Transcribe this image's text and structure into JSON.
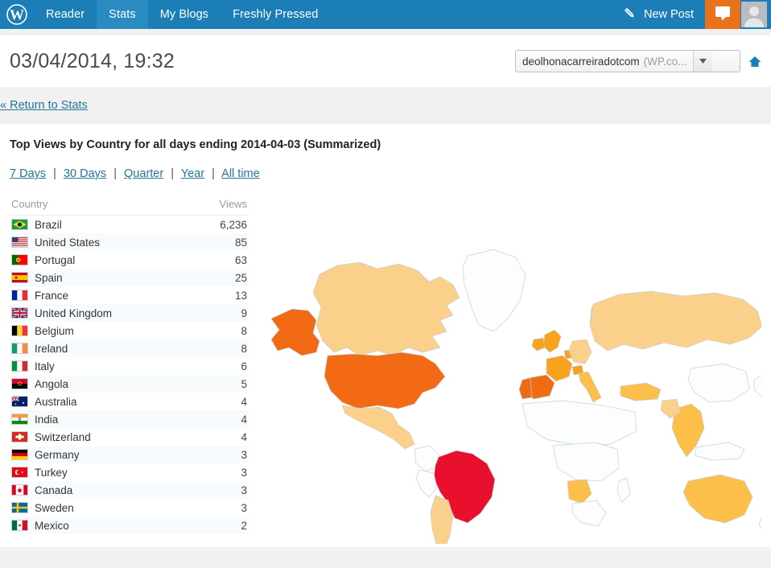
{
  "masterbar": {
    "logo_icon": "wordpress-logo-icon",
    "items": [
      {
        "label": "Reader",
        "active": false
      },
      {
        "label": "Stats",
        "active": true
      },
      {
        "label": "My Blogs",
        "active": false
      },
      {
        "label": "Freshly Pressed",
        "active": false
      }
    ],
    "new_post_label": "New Post",
    "new_post_icon": "pencil-icon",
    "notification_icon": "comment-bubble-icon",
    "avatar_icon": "user-avatar-icon",
    "bar_color": "#1c7eb6",
    "active_color": "#2a8bc0",
    "notification_color": "#e8731c"
  },
  "header": {
    "title": "03/04/2014, 19:32",
    "site_name": "deolhonacarreiradotcom",
    "site_suffix": "(WP.co...",
    "dropdown_icon": "chevron-down-icon",
    "home_icon": "home-icon"
  },
  "return": {
    "label": "« Return to Stats"
  },
  "panel": {
    "heading": "Top Views by Country for all days ending 2014-04-03 (Summarized)",
    "periods": [
      {
        "label": "7 Days"
      },
      {
        "label": "30 Days"
      },
      {
        "label": "Quarter"
      },
      {
        "label": "Year"
      },
      {
        "label": "All time"
      }
    ],
    "separator": "|"
  },
  "table": {
    "columns": [
      "Country",
      "Views"
    ],
    "rows": [
      {
        "country": "Brazil",
        "views": "6,236",
        "flag": "br"
      },
      {
        "country": "United States",
        "views": "85",
        "flag": "us"
      },
      {
        "country": "Portugal",
        "views": "63",
        "flag": "pt"
      },
      {
        "country": "Spain",
        "views": "25",
        "flag": "es"
      },
      {
        "country": "France",
        "views": "13",
        "flag": "fr"
      },
      {
        "country": "United Kingdom",
        "views": "9",
        "flag": "gb"
      },
      {
        "country": "Belgium",
        "views": "8",
        "flag": "be"
      },
      {
        "country": "Ireland",
        "views": "8",
        "flag": "ie"
      },
      {
        "country": "Italy",
        "views": "6",
        "flag": "it"
      },
      {
        "country": "Angola",
        "views": "5",
        "flag": "ao"
      },
      {
        "country": "Australia",
        "views": "4",
        "flag": "au"
      },
      {
        "country": "India",
        "views": "4",
        "flag": "in"
      },
      {
        "country": "Switzerland",
        "views": "4",
        "flag": "ch"
      },
      {
        "country": "Germany",
        "views": "3",
        "flag": "de"
      },
      {
        "country": "Turkey",
        "views": "3",
        "flag": "tr"
      },
      {
        "country": "Canada",
        "views": "3",
        "flag": "ca"
      },
      {
        "country": "Sweden",
        "views": "3",
        "flag": "se"
      },
      {
        "country": "Mexico",
        "views": "2",
        "flag": "mx"
      }
    ]
  },
  "chart_data": {
    "type": "heatmap",
    "title": "Top Views by Country for all days ending 2014-04-03 (Summarized)",
    "xlabel": "",
    "ylabel": "Views",
    "categories": [
      "Brazil",
      "United States",
      "Portugal",
      "Spain",
      "France",
      "United Kingdom",
      "Belgium",
      "Ireland",
      "Italy",
      "Angola",
      "Australia",
      "India",
      "Switzerland",
      "Germany",
      "Turkey",
      "Canada",
      "Sweden",
      "Mexico"
    ],
    "values": [
      6236,
      85,
      63,
      25,
      13,
      9,
      8,
      8,
      6,
      5,
      4,
      4,
      4,
      3,
      3,
      3,
      3,
      2
    ],
    "legend_position": "none",
    "grid": false,
    "color_scale": {
      "highest": "#e8102d",
      "high": "#f26a14",
      "medium": "#faa21b",
      "low": "#fcbf49",
      "lowest": "#fbd08a",
      "nodata": "#fbfdfe",
      "border": "#c8ced4"
    },
    "region_colors": {
      "Brazil": "#e8102d",
      "United States": "#f26a14",
      "Portugal": "#ef6b14",
      "Spain": "#ef6b14",
      "United Kingdom": "#faa21b",
      "France": "#faa21b",
      "Belgium": "#faa21b",
      "Ireland": "#faa21b",
      "Italy": "#fcbf49",
      "Angola": "#fcbf49",
      "Australia": "#fcbf49",
      "India": "#fcbf49",
      "Switzerland": "#faa21b",
      "Germany": "#fbd08a",
      "Turkey": "#fcbf49",
      "Canada": "#fbd08a",
      "Sweden": "#fbd08a",
      "Mexico": "#fbd08a",
      "Russia": "#fbd08a",
      "Argentina": "#fbd08a",
      "Pakistan": "#fbd08a",
      "Greenland": "#fbfdfe"
    }
  }
}
